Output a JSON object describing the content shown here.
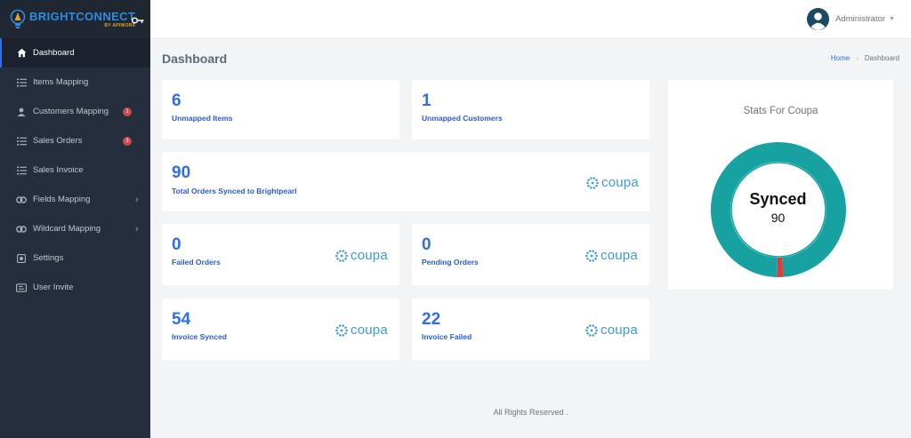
{
  "brand": {
    "name": "BRIGHTCONNECT",
    "sub": "BY APIWORX"
  },
  "sidebar": {
    "items": [
      {
        "label": "Dashboard",
        "icon": "home-icon",
        "active": true
      },
      {
        "label": "Items Mapping",
        "icon": "list-icon"
      },
      {
        "label": "Customers Mapping",
        "icon": "user-icon",
        "badge": "1"
      },
      {
        "label": "Sales Orders",
        "icon": "list-icon",
        "badge": "3"
      },
      {
        "label": "Sales Invoice",
        "icon": "list-icon"
      },
      {
        "label": "Fields Mapping",
        "icon": "link-icon",
        "chevron": true
      },
      {
        "label": "Wildcard Mapping",
        "icon": "link-icon",
        "chevron": true
      },
      {
        "label": "Settings",
        "icon": "gear-icon"
      },
      {
        "label": "User Invite",
        "icon": "user-invite-icon"
      }
    ]
  },
  "header": {
    "user_name": "Administrator"
  },
  "page": {
    "title": "Dashboard"
  },
  "breadcrumb": {
    "home": "Home",
    "current": "Dashboard"
  },
  "cards": {
    "unmapped_items": {
      "value": "6",
      "label": "Unmapped Items"
    },
    "unmapped_customers": {
      "value": "1",
      "label": "Unmapped Customers"
    },
    "total_orders": {
      "value": "90",
      "label": "Total Orders Synced to Brightpearl"
    },
    "failed_orders": {
      "value": "0",
      "label": "Failed Orders"
    },
    "pending_orders": {
      "value": "0",
      "label": "Pending Orders"
    },
    "invoice_synced": {
      "value": "54",
      "label": "Invoice Synced"
    },
    "invoice_failed": {
      "value": "22",
      "label": "Invoice Failed"
    }
  },
  "coupa_logo_text": "coupa",
  "stats": {
    "title": "Stats For Coupa",
    "center_label": "Synced",
    "center_value": "90",
    "synced_fraction": 0.985,
    "colors": {
      "synced": "#17a2a1",
      "failed": "#e03c3c"
    }
  },
  "footer": {
    "text": "All Rights Reserved ."
  },
  "colors": {
    "accent": "#2f6fe0",
    "sidebar": "#252e3c",
    "badge": "#c94a4a"
  }
}
